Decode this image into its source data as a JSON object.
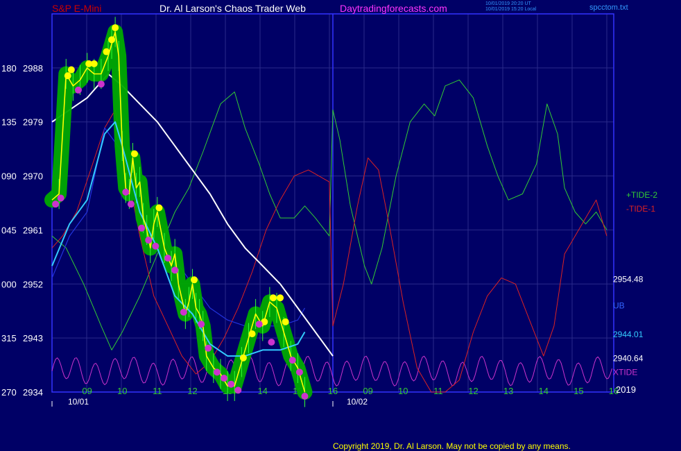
{
  "header": {
    "symbol": "S&P E-Mini",
    "title": "Dr. Al Larson's Chaos Trader Web",
    "site": "Daytradingforecasts.com",
    "stamp1": "10/01/2019 20:20 UT",
    "stamp2": "10/01/2019 15:20 Local",
    "file": "spcctom.txt"
  },
  "copyright": "Copyright 2019, Dr. Al Larson. May not be copied by any means.",
  "colors": {
    "background": "#000066",
    "plot_border": "#3333ff",
    "grid": "#2a2a8a",
    "price": "#ffff00",
    "ma_fast": "#33ccff",
    "ma_mid": "#2233dd",
    "ma_slow": "#ffffff",
    "tide_plus2": "#33cc33",
    "tide_minus1": "#dd2222",
    "xtide": "#cc33cc",
    "highlight": "#00aa00",
    "top_dot": "#ffff00",
    "bottom_dot": "#cc33cc"
  },
  "chart_data": {
    "type": "line",
    "title": "S&P E-Mini",
    "y_axis": {
      "range": [
        2934,
        2997
      ],
      "ticks": [
        {
          "value": 2934,
          "label": "2934",
          "tide_label": "270"
        },
        {
          "value": 2943,
          "label": "2943",
          "tide_label": "315"
        },
        {
          "value": 2952,
          "label": "2952",
          "tide_label": "000"
        },
        {
          "value": 2961,
          "label": "2961",
          "tide_label": "045"
        },
        {
          "value": 2970,
          "label": "2970",
          "tide_label": "090"
        },
        {
          "value": 2979,
          "label": "2979",
          "tide_label": "135"
        },
        {
          "value": 2988,
          "label": "2988",
          "tide_label": "180"
        }
      ]
    },
    "x_axis": {
      "range": [
        8,
        16.1
      ],
      "split_at": 16,
      "hours_day1": [
        "09",
        "10",
        "11",
        "12",
        "13",
        "14",
        "15",
        "16"
      ],
      "hours_day2": [
        "09",
        "10",
        "11",
        "12",
        "13",
        "14",
        "15",
        "16"
      ],
      "dates": [
        "10/01",
        "10/02"
      ],
      "year_label": "2019"
    },
    "series": [
      {
        "key": "price",
        "color": "#ffff00",
        "points": [
          [
            8.0,
            2966
          ],
          [
            8.2,
            2967
          ],
          [
            8.4,
            2987
          ],
          [
            8.6,
            2985
          ],
          [
            8.8,
            2986
          ],
          [
            9.0,
            2988
          ],
          [
            9.2,
            2987
          ],
          [
            9.4,
            2987
          ],
          [
            9.6,
            2990
          ],
          [
            9.7,
            2992
          ],
          [
            9.8,
            2994
          ],
          [
            9.9,
            2990
          ],
          [
            10.0,
            2975
          ],
          [
            10.1,
            2968
          ],
          [
            10.2,
            2967
          ],
          [
            10.3,
            2973
          ],
          [
            10.4,
            2968
          ],
          [
            10.5,
            2969
          ],
          [
            10.6,
            2963
          ],
          [
            10.7,
            2961
          ],
          [
            10.8,
            2958
          ],
          [
            10.9,
            2962
          ],
          [
            11.0,
            2964
          ],
          [
            11.2,
            2958
          ],
          [
            11.4,
            2955
          ],
          [
            11.5,
            2957
          ],
          [
            11.6,
            2952
          ],
          [
            11.8,
            2947
          ],
          [
            11.9,
            2949
          ],
          [
            12.0,
            2952
          ],
          [
            12.1,
            2948
          ],
          [
            12.2,
            2947
          ],
          [
            12.3,
            2945
          ],
          [
            12.4,
            2940
          ],
          [
            12.6,
            2938
          ],
          [
            12.8,
            2937
          ],
          [
            13.0,
            2935
          ],
          [
            13.2,
            2935
          ],
          [
            13.4,
            2939
          ],
          [
            13.6,
            2943
          ],
          [
            13.8,
            2947
          ],
          [
            14.0,
            2945
          ],
          [
            14.2,
            2949
          ],
          [
            14.4,
            2948
          ],
          [
            14.6,
            2944
          ],
          [
            14.8,
            2940
          ],
          [
            15.0,
            2938
          ],
          [
            15.2,
            2934
          ]
        ]
      },
      {
        "key": "ma_fast",
        "color": "#33ccff",
        "points": [
          [
            8.0,
            2955
          ],
          [
            8.5,
            2962
          ],
          [
            9.0,
            2966
          ],
          [
            9.5,
            2977
          ],
          [
            9.8,
            2979
          ],
          [
            10.0,
            2975
          ],
          [
            10.5,
            2964
          ],
          [
            11.0,
            2958
          ],
          [
            11.5,
            2950
          ],
          [
            12.0,
            2947
          ],
          [
            12.5,
            2942
          ],
          [
            13.0,
            2940
          ],
          [
            13.5,
            2940
          ],
          [
            14.0,
            2941
          ],
          [
            14.5,
            2941
          ],
          [
            15.0,
            2942
          ],
          [
            15.2,
            2944
          ]
        ]
      },
      {
        "key": "ma_mid",
        "color": "#2233dd",
        "points": [
          [
            8.0,
            2953
          ],
          [
            8.5,
            2960
          ],
          [
            9.0,
            2964
          ],
          [
            9.5,
            2978
          ],
          [
            10.0,
            2974
          ],
          [
            10.5,
            2968
          ],
          [
            11.0,
            2962
          ],
          [
            11.5,
            2956
          ],
          [
            12.0,
            2952
          ],
          [
            12.5,
            2948
          ],
          [
            13.0,
            2946
          ],
          [
            13.5,
            2945
          ],
          [
            14.0,
            2945
          ],
          [
            14.5,
            2945
          ],
          [
            15.0,
            2946
          ],
          [
            15.2,
            2948
          ]
        ]
      },
      {
        "key": "ma_slow",
        "color": "#ffffff",
        "points": [
          [
            8.0,
            2979
          ],
          [
            8.5,
            2981
          ],
          [
            9.0,
            2983
          ],
          [
            9.3,
            2985
          ],
          [
            9.6,
            2987
          ],
          [
            10.0,
            2985
          ],
          [
            10.5,
            2982
          ],
          [
            11.0,
            2979
          ],
          [
            11.5,
            2975
          ],
          [
            12.0,
            2971
          ],
          [
            12.5,
            2967
          ],
          [
            13.0,
            2962
          ],
          [
            13.5,
            2958
          ],
          [
            14.0,
            2955
          ],
          [
            14.5,
            2952
          ],
          [
            15.0,
            2948
          ],
          [
            15.5,
            2944
          ],
          [
            16.0,
            2940
          ]
        ]
      },
      {
        "key": "tide_plus2",
        "color": "#33cc33",
        "label": "+TIDE-2",
        "points": [
          [
            8.0,
            2960
          ],
          [
            8.4,
            2958
          ],
          [
            8.9,
            2952
          ],
          [
            9.4,
            2945
          ],
          [
            9.7,
            2941
          ],
          [
            10.0,
            2944
          ],
          [
            10.5,
            2950
          ],
          [
            11.0,
            2957
          ],
          [
            11.5,
            2964
          ],
          [
            11.9,
            2968
          ],
          [
            12.3,
            2974
          ],
          [
            12.8,
            2982
          ],
          [
            13.2,
            2984
          ],
          [
            13.5,
            2978
          ],
          [
            13.9,
            2972
          ],
          [
            14.2,
            2967
          ],
          [
            14.5,
            2963
          ],
          [
            14.9,
            2963
          ],
          [
            15.2,
            2965
          ],
          [
            15.5,
            2963
          ],
          [
            15.9,
            2960
          ],
          [
            16.0,
            2981
          ],
          [
            16.2,
            2976
          ],
          [
            16.5,
            2965
          ],
          [
            16.9,
            2955
          ],
          [
            17.1,
            2952
          ],
          [
            17.4,
            2958
          ],
          [
            17.8,
            2970
          ],
          [
            18.2,
            2979
          ],
          [
            18.6,
            2982
          ],
          [
            18.9,
            2980
          ],
          [
            19.2,
            2985
          ],
          [
            19.6,
            2986
          ],
          [
            20.0,
            2983
          ],
          [
            20.4,
            2975
          ],
          [
            20.7,
            2970
          ],
          [
            21.0,
            2966
          ],
          [
            21.4,
            2967
          ],
          [
            21.8,
            2972
          ],
          [
            22.1,
            2982
          ],
          [
            22.4,
            2977
          ],
          [
            22.6,
            2968
          ],
          [
            22.9,
            2964
          ],
          [
            23.2,
            2962
          ],
          [
            23.5,
            2964
          ],
          [
            23.8,
            2961
          ]
        ]
      },
      {
        "key": "tide_minus1",
        "color": "#dd2222",
        "label": "-TIDE-1",
        "points": [
          [
            8.0,
            2958
          ],
          [
            8.3,
            2960
          ],
          [
            8.7,
            2964
          ],
          [
            9.1,
            2971
          ],
          [
            9.5,
            2978
          ],
          [
            9.8,
            2981
          ],
          [
            10.1,
            2972
          ],
          [
            10.5,
            2960
          ],
          [
            10.9,
            2950
          ],
          [
            11.3,
            2945
          ],
          [
            11.7,
            2940
          ],
          [
            12.1,
            2937
          ],
          [
            12.5,
            2939
          ],
          [
            12.9,
            2943
          ],
          [
            13.3,
            2948
          ],
          [
            13.7,
            2954
          ],
          [
            14.1,
            2961
          ],
          [
            14.5,
            2966
          ],
          [
            14.9,
            2970
          ],
          [
            15.3,
            2971
          ],
          [
            15.6,
            2970
          ],
          [
            15.9,
            2969
          ],
          [
            16.0,
            2945
          ],
          [
            16.3,
            2952
          ],
          [
            16.7,
            2965
          ],
          [
            17.0,
            2973
          ],
          [
            17.3,
            2971
          ],
          [
            17.6,
            2962
          ],
          [
            18.0,
            2949
          ],
          [
            18.4,
            2938
          ],
          [
            18.8,
            2934
          ],
          [
            19.2,
            2934
          ],
          [
            19.6,
            2936
          ],
          [
            20.0,
            2944
          ],
          [
            20.4,
            2950
          ],
          [
            20.8,
            2953
          ],
          [
            21.2,
            2952
          ],
          [
            21.6,
            2946
          ],
          [
            22.0,
            2940
          ],
          [
            22.3,
            2945
          ],
          [
            22.6,
            2957
          ],
          [
            22.9,
            2960
          ],
          [
            23.2,
            2963
          ],
          [
            23.5,
            2966
          ],
          [
            23.8,
            2960
          ]
        ]
      },
      {
        "key": "xtide",
        "color": "#cc33cc",
        "label": "XTIDE",
        "phase": 0,
        "center": 2937.5,
        "amp": 1.9,
        "period": 0.55
      }
    ],
    "markers": {
      "tops": [
        [
          8.45,
          2986
        ],
        [
          8.55,
          2987
        ],
        [
          9.05,
          2988
        ],
        [
          9.2,
          2988
        ],
        [
          9.55,
          2990
        ],
        [
          9.7,
          2992
        ],
        [
          9.8,
          2994
        ],
        [
          10.35,
          2973
        ],
        [
          11.05,
          2964
        ],
        [
          12.05,
          2952
        ],
        [
          13.45,
          2939
        ],
        [
          13.7,
          2943
        ],
        [
          14.05,
          2945
        ],
        [
          14.3,
          2949
        ],
        [
          14.5,
          2949
        ],
        [
          14.65,
          2945
        ]
      ],
      "bottoms": [
        [
          8.1,
          2966
        ],
        [
          8.25,
          2967
        ],
        [
          8.75,
          2985
        ],
        [
          9.4,
          2986
        ],
        [
          10.1,
          2968
        ],
        [
          10.25,
          2966
        ],
        [
          10.55,
          2962
        ],
        [
          10.75,
          2960
        ],
        [
          10.95,
          2959
        ],
        [
          11.3,
          2957
        ],
        [
          11.5,
          2955
        ],
        [
          11.75,
          2948
        ],
        [
          12.25,
          2946
        ],
        [
          12.45,
          2942
        ],
        [
          12.7,
          2938
        ],
        [
          12.9,
          2937
        ],
        [
          13.1,
          2936
        ],
        [
          13.3,
          2935
        ],
        [
          13.9,
          2946
        ],
        [
          14.25,
          2943
        ],
        [
          14.85,
          2940
        ],
        [
          15.05,
          2938
        ],
        [
          15.2,
          2934
        ]
      ]
    },
    "right_labels": [
      {
        "text": "2954.48",
        "color": "#ffffff",
        "value": 2952.8
      },
      {
        "text": "UB",
        "color": "#3366ff",
        "value": 2948.4
      },
      {
        "text": "2944.01",
        "color": "#33ccff",
        "value": 2943.6
      },
      {
        "text": "2940.64",
        "color": "#ffffff",
        "value": 2939.6
      },
      {
        "text": "XTIDE",
        "color": "#cc33cc",
        "value": 2937.3
      }
    ],
    "legend": [
      {
        "text": "+TIDE-2",
        "color": "#33cc33"
      },
      {
        "text": "-TIDE-1",
        "color": "#dd2222"
      }
    ]
  }
}
